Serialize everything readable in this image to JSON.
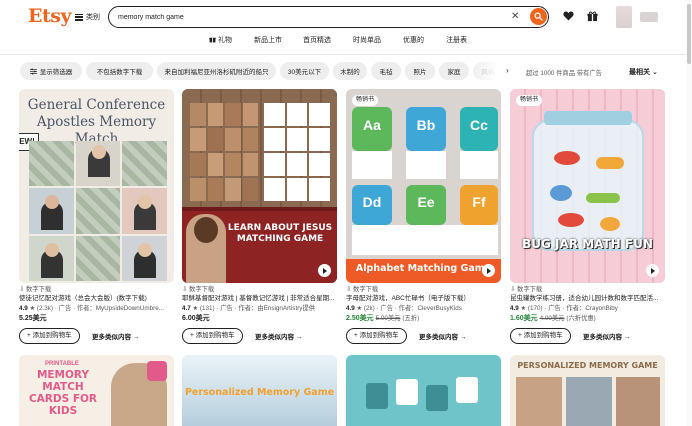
{
  "header": {
    "logo": "Etsy",
    "categories_label": "类别",
    "search_value": "memory match game",
    "icons": [
      "search-icon",
      "clear-icon",
      "heart-icon",
      "gift-icon",
      "account-icon"
    ]
  },
  "nav": [
    "礼物",
    "新品上市",
    "首页精选",
    "时尚单品",
    "优惠的",
    "注册表"
  ],
  "filters": {
    "show_filters": "显示筛选器",
    "chips": [
      "不包括数字下载",
      "来自加利福尼亚州洛杉矶附近的船只",
      "30美元以下",
      "木制的",
      "毛毡",
      "照片",
      "家庭",
      "风俗"
    ],
    "results_text": "超过 1000 件商品  带有广告",
    "sort_label": "最相关"
  },
  "colors": {
    "accent": "#f1641e",
    "sale_green": "#258635"
  },
  "products": [
    {
      "badge": "",
      "image_text": "General Conference Apostles Memory Match",
      "image_tag": "EW!",
      "download": "数字下载",
      "title": "使徒记忆配对游戏（总会大会版）(数字下载)",
      "rating": "4.9",
      "reviews": "(2.3k)",
      "ad_seller": "广告 · 作者：MyUpsideDownUmbre...",
      "price": "5.25美元",
      "original_price": "",
      "discount": "",
      "add_label": "添加到购物车",
      "more_label": "更多类似内容"
    },
    {
      "badge": "",
      "image_text": "LEARN ABOUT JESUS MATCHING GAME",
      "image_tag": "",
      "download": "数字下载",
      "title": "耶稣基督配对游戏 | 基督教记忆游戏 | 非常适合星期...",
      "rating": "4.7",
      "reviews": "(131)",
      "ad_seller": "广告 · 作者：由EnsignArtistry提供",
      "price": "6.00美元",
      "original_price": "",
      "discount": "",
      "add_label": "添加到购物车",
      "more_label": "更多类似内容"
    },
    {
      "badge": "畅销书",
      "image_text": "Alphabet Matching Game",
      "image_tag": "",
      "download": "数字下载",
      "title": "字母配对游戏，ABC忙碌书（电子版下载）",
      "rating": "4.9",
      "reviews": "(2k)",
      "ad_seller": "广告 · 作者：CleverBusyKids",
      "price": "2.50美元",
      "original_price": "5.00美元",
      "discount": "(五折)",
      "add_label": "添加到购物车",
      "more_label": "更多类似内容"
    },
    {
      "badge": "畅销书",
      "image_text": "BUG JAR MATH FUN",
      "image_tag": "",
      "download": "数字下载",
      "title": "昆虫罐数学练习册，适合幼儿园计数和数字匹配活...",
      "rating": "4.9",
      "reviews": "(170)",
      "ad_seller": "广告 · 作者：CrayonBiby",
      "price": "1.60美元",
      "original_price": "4.00美元",
      "discount": "(六折优惠)",
      "add_label": "添加到购物车",
      "more_label": "更多类似内容"
    }
  ],
  "row2": [
    {
      "image_text": "MEMORY MATCH CARDS FOR KIDS",
      "image_sub": "PRINTABLE"
    },
    {
      "image_text": "Personalized Memory Game",
      "image_sub": ""
    },
    {
      "image_text": "",
      "image_sub": ""
    },
    {
      "image_text": "PERSONALIZED MEMORY GAME",
      "image_sub": ""
    }
  ]
}
